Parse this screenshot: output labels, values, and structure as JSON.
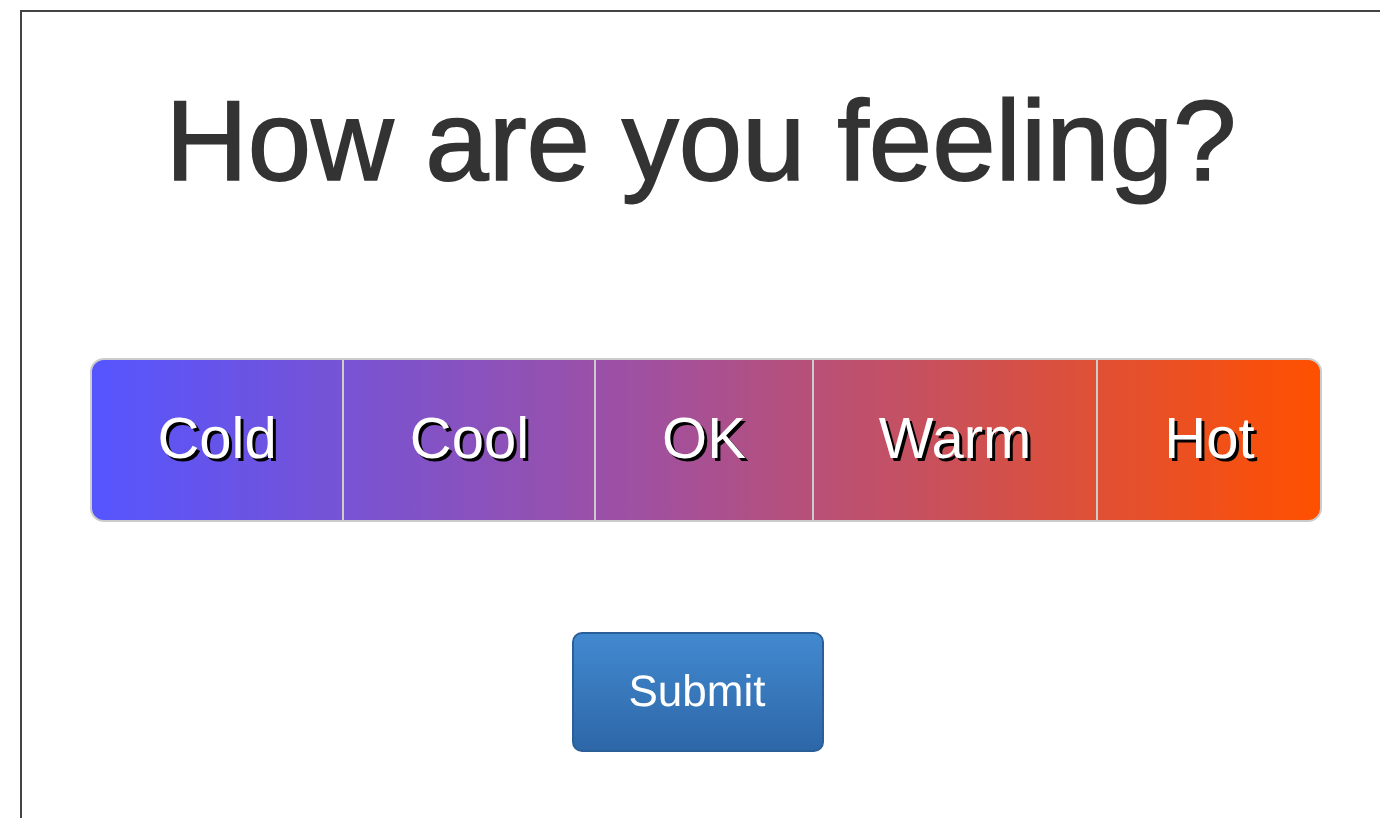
{
  "heading": "How are you feeling?",
  "options": [
    {
      "label": "Cold",
      "selected": false
    },
    {
      "label": "Cool",
      "selected": false
    },
    {
      "label": "OK",
      "selected": false
    },
    {
      "label": "Warm",
      "selected": false
    },
    {
      "label": "Hot",
      "selected": false
    }
  ],
  "submit": "Submit"
}
